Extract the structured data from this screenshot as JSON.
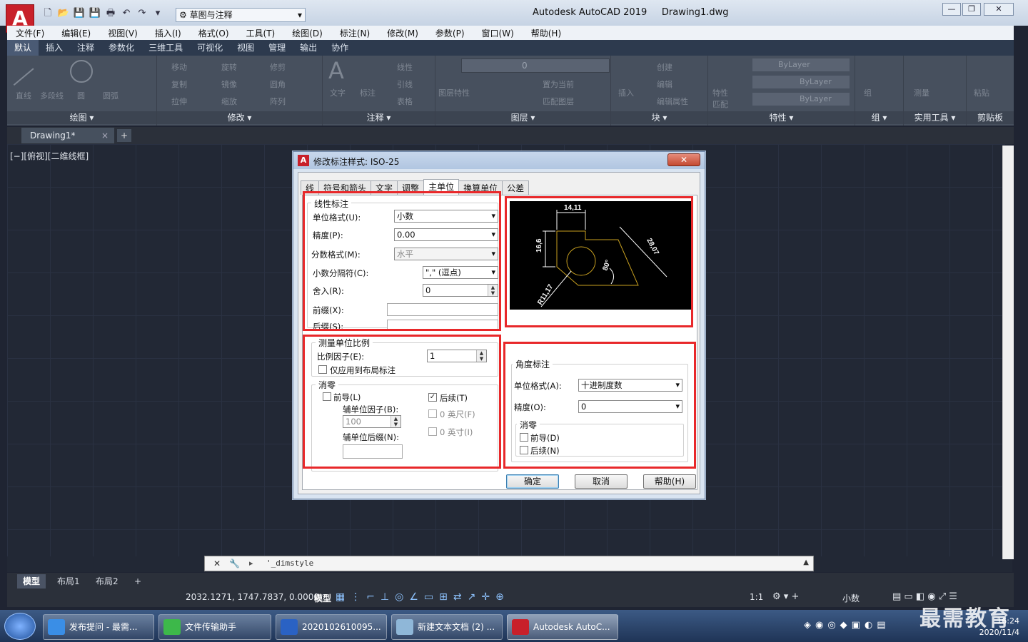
{
  "window": {
    "app_title": "Autodesk AutoCAD 2019",
    "file": "Drawing1.dwg",
    "logo": "A",
    "workspace": "草图与注释"
  },
  "menu": [
    "文件(F)",
    "编辑(E)",
    "视图(V)",
    "插入(I)",
    "格式(O)",
    "工具(T)",
    "绘图(D)",
    "标注(N)",
    "修改(M)",
    "参数(P)",
    "窗口(W)",
    "帮助(H)"
  ],
  "ribbon_tabs": [
    "默认",
    "插入",
    "注释",
    "参数化",
    "三维工具",
    "可视化",
    "视图",
    "管理",
    "输出",
    "协作"
  ],
  "ribbon_panels": [
    "绘图 ▾",
    "修改 ▾",
    "注释 ▾",
    "图层 ▾",
    "块 ▾",
    "特性 ▾",
    "组 ▾",
    "实用工具 ▾",
    "剪贴板"
  ],
  "ribbon_tools": {
    "draw": [
      "直线",
      "多段线",
      "圆",
      "圆弧"
    ],
    "modify": [
      "移动",
      "旋转",
      "修剪",
      "复制",
      "镜像",
      "圆角",
      "拉伸",
      "缩放",
      "阵列"
    ],
    "annot": [
      "文字",
      "标注",
      "线性",
      "引线",
      "表格"
    ],
    "layer": [
      "图层特性",
      "0",
      "置为当前",
      "匹配图层"
    ],
    "block": [
      "插入",
      "创建",
      "编辑",
      "编辑属性"
    ],
    "props": [
      "特性匹配",
      "ByLayer",
      "ByLayer",
      "ByLayer"
    ],
    "util": [
      "组",
      "测量",
      "粘贴"
    ]
  },
  "doc_tab": "Drawing1*",
  "viewport_label": "[−][俯视][二维线框]",
  "dialog": {
    "title": "修改标注样式: ISO-25",
    "tabs": [
      "线",
      "符号和箭头",
      "文字",
      "调整",
      "主单位",
      "换算单位",
      "公差"
    ],
    "linear": {
      "group": "线性标注",
      "unit_format_label": "单位格式(U):",
      "unit_format": "小数",
      "precision_label": "精度(P):",
      "precision": "0.00",
      "fraction_label": "分数格式(M):",
      "fraction": "水平",
      "decimal_sep_label": "小数分隔符(C):",
      "decimal_sep": "\",\" (逗点)",
      "round_label": "舍入(R):",
      "round": "0",
      "prefix_label": "前缀(X):",
      "suffix_label": "后缀(S):"
    },
    "scale": {
      "group": "测量单位比例",
      "factor_label": "比例因子(E):",
      "factor": "1",
      "layout_only": "仅应用到布局标注"
    },
    "zero": {
      "group": "消零",
      "leading": "前导(L)",
      "trailing": "后续(T)",
      "sub_factor_label": "辅单位因子(B):",
      "sub_factor": "100",
      "feet": "0 英尺(F)",
      "inches": "0 英寸(I)",
      "sub_suffix_label": "辅单位后缀(N):"
    },
    "angular": {
      "group": "角度标注",
      "unit_format_label": "单位格式(A):",
      "unit_format": "十进制度数",
      "precision_label": "精度(O):",
      "precision": "0",
      "zero_group": "消零",
      "leading": "前导(D)",
      "trailing": "后续(N)"
    },
    "preview": {
      "dim_top": "14,11",
      "dim_left": "16,6",
      "dim_diag": "28,07",
      "angle": "80°",
      "radius": "R11,17"
    },
    "buttons": {
      "ok": "确定",
      "cancel": "取消",
      "help": "帮助(H)"
    }
  },
  "command_line": "'_dimstyle",
  "layout_tabs": [
    "模型",
    "布局1",
    "布局2"
  ],
  "status": {
    "coords": "2032.1271, 1747.7837, 0.0000",
    "model": "模型",
    "scale": "1:1",
    "units": "小数"
  },
  "taskbar": {
    "items": [
      "发布提问 - 最需...",
      "文件传输助手",
      "2020102610095...",
      "新建文本文档 (2) ...",
      "Autodesk AutoC..."
    ],
    "time": "16:24",
    "date": "2020/11/4"
  },
  "watermark": "最需教育",
  "colors": {
    "accent": "#e8282a",
    "canvas": "#222835",
    "ribbon": "#47505e",
    "preview_line": "#c8a020"
  }
}
